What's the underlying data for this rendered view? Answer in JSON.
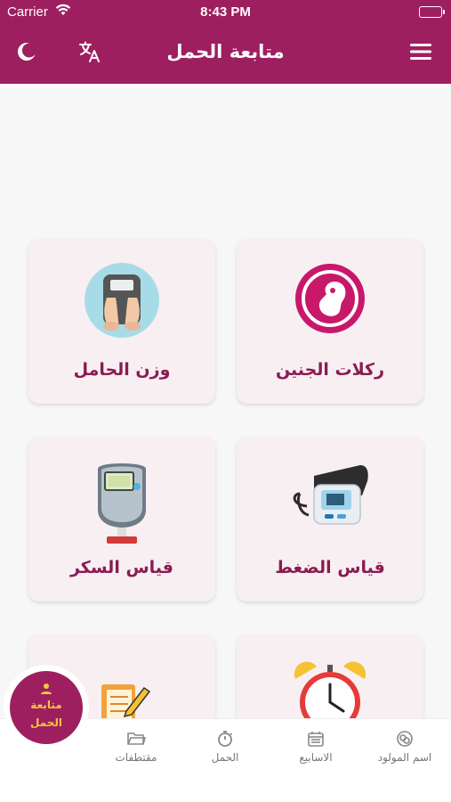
{
  "status_bar": {
    "carrier": "Carrier",
    "time": "8:43 PM"
  },
  "header": {
    "title": "متابعة الحمل"
  },
  "cards": [
    {
      "label": "ركلات الجنين",
      "icon": "fetus-icon"
    },
    {
      "label": "وزن الحامل",
      "icon": "weight-scale-icon"
    },
    {
      "label": "قياس الضغط",
      "icon": "blood-pressure-monitor-icon"
    },
    {
      "label": "قياس السكر",
      "icon": "glucose-meter-icon"
    },
    {
      "label": "",
      "icon": "alarm-clock-icon"
    },
    {
      "label": "",
      "icon": "notebook-pencil-icon"
    }
  ],
  "bottom_tabs": [
    {
      "label": "اسم المولود",
      "icon": "baby-name-icon"
    },
    {
      "label": "الاسابيع",
      "icon": "calendar-icon"
    },
    {
      "label": "الحمل",
      "icon": "timer-icon"
    },
    {
      "label": "مقتطفات",
      "icon": "folder-icon"
    }
  ],
  "fab": {
    "label_line1": "متابعة",
    "label_line2": "الحمل",
    "icon": "person-icon"
  },
  "colors": {
    "primary": "#9e1f5f",
    "accent": "#f5c542",
    "card_bg": "#f7eff2",
    "label": "#8a1b52"
  }
}
